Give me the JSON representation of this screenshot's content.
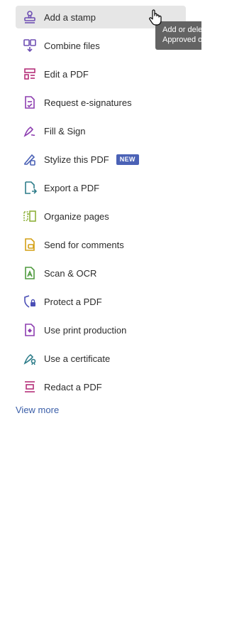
{
  "tools": [
    {
      "label": "Add a stamp",
      "icon": "stamp-icon",
      "color": "#6e4fb3"
    },
    {
      "label": "Combine files",
      "icon": "combine-files-icon",
      "color": "#6e4fb3"
    },
    {
      "label": "Edit a PDF",
      "icon": "edit-pdf-icon",
      "color": "#b5307a"
    },
    {
      "label": "Request e-signatures",
      "icon": "request-esign-icon",
      "color": "#8d3eb0"
    },
    {
      "label": "Fill & Sign",
      "icon": "fill-sign-icon",
      "color": "#8d3eb0"
    },
    {
      "label": "Stylize this PDF",
      "icon": "stylize-icon",
      "color": "#4b62b6",
      "badge": "NEW"
    },
    {
      "label": "Export a PDF",
      "icon": "export-pdf-icon",
      "color": "#2e7d8a"
    },
    {
      "label": "Organize pages",
      "icon": "organize-pages-icon",
      "color": "#8db03a"
    },
    {
      "label": "Send for comments",
      "icon": "send-comments-icon",
      "color": "#d4a017"
    },
    {
      "label": "Scan & OCR",
      "icon": "scan-ocr-icon",
      "color": "#4f9a3e"
    },
    {
      "label": "Protect a PDF",
      "icon": "protect-pdf-icon",
      "color": "#4b4fb6"
    },
    {
      "label": "Use print production",
      "icon": "print-production-icon",
      "color": "#8d3eb0"
    },
    {
      "label": "Use a certificate",
      "icon": "certificate-icon",
      "color": "#2e7d8a"
    },
    {
      "label": "Redact a PDF",
      "icon": "redact-pdf-icon",
      "color": "#b5307a"
    }
  ],
  "view_more": "View more",
  "tooltip": {
    "line1": "Add or dele",
    "line2": "Approved o"
  },
  "colors": {
    "hover_bg": "#e6e6e6",
    "link": "#3a5ea8",
    "badge": "#4b62b6",
    "tooltip_bg": "#636363"
  }
}
